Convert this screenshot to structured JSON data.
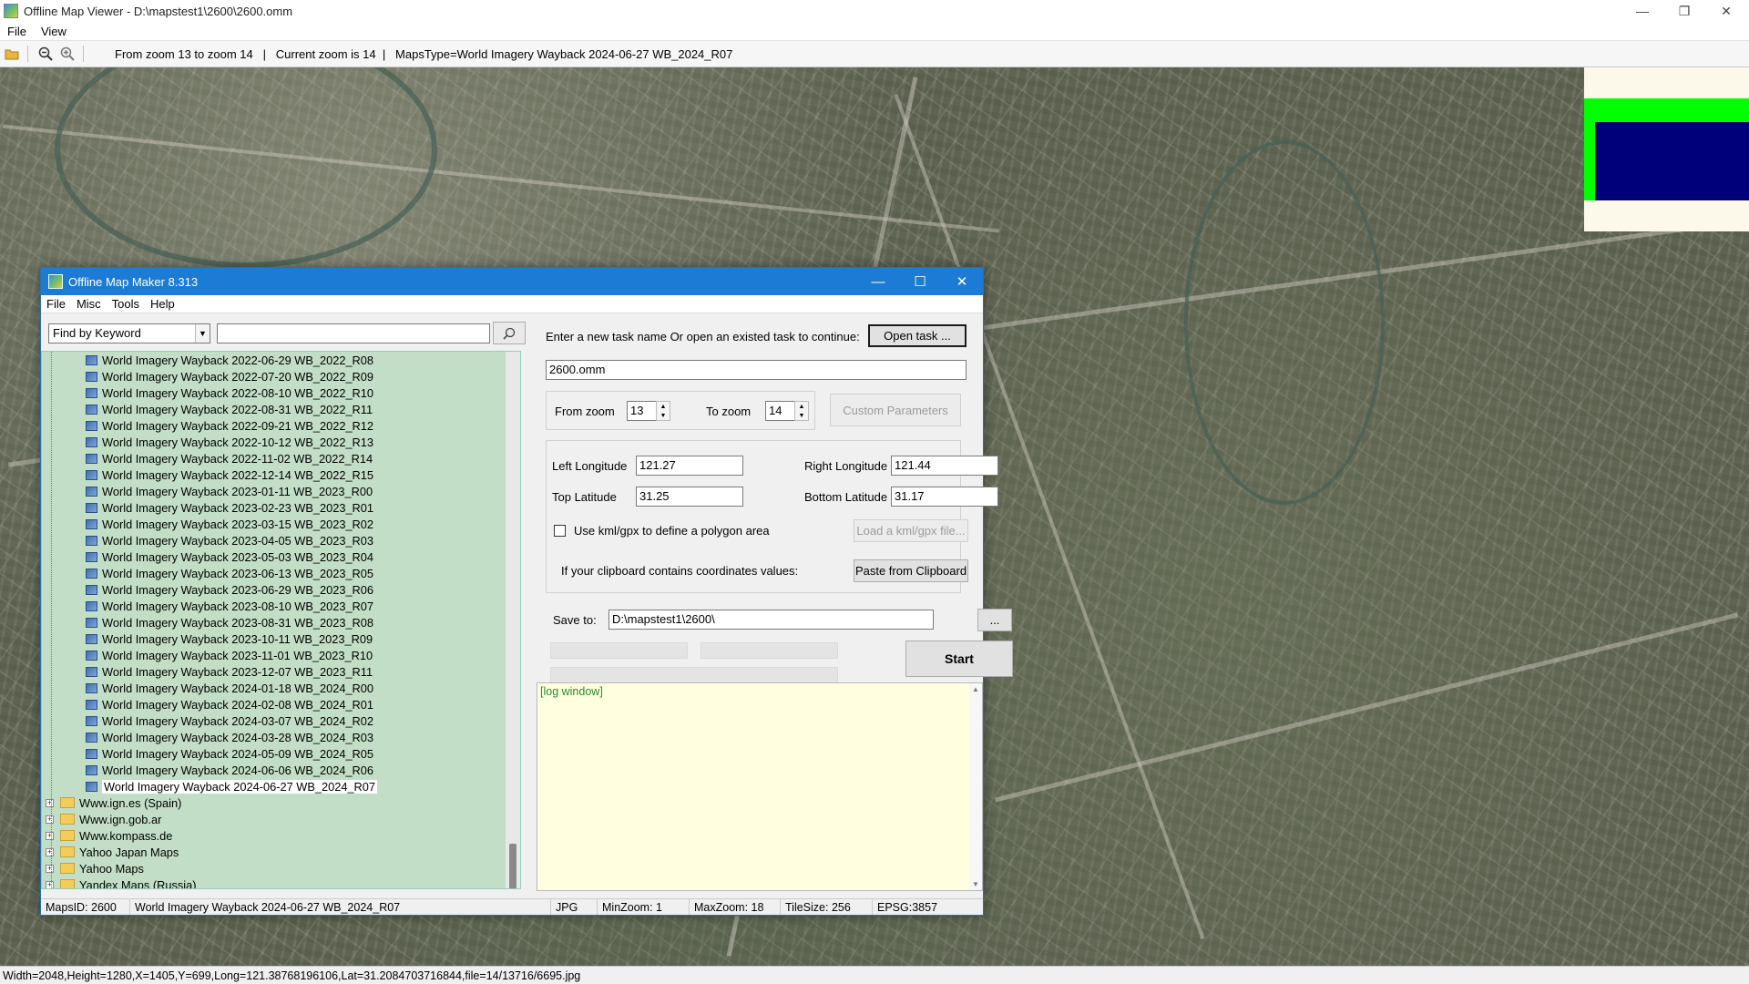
{
  "window": {
    "title": "Offline Map Viewer - D:\\mapstest1\\2600\\2600.omm",
    "controls": {
      "minimize": "—",
      "maximize": "❐",
      "close": "✕"
    }
  },
  "menu": [
    "File",
    "View"
  ],
  "toolbar": {
    "info": "From zoom 13 to zoom 14   |   Current zoom is 14  |   MapsType=World Imagery Wayback 2024-06-27 WB_2024_R07"
  },
  "statusbar": {
    "text": "Width=2048,Height=1280,X=1405,Y=699,Long=121.38768196106,Lat=31.2084703716844,file=14/13716/6695.jpg"
  },
  "dialog": {
    "title": "Offline Map Maker 8.313",
    "menu": [
      "File",
      "Misc",
      "Tools",
      "Help"
    ],
    "search": {
      "mode": "Find by Keyword",
      "keyword": ""
    },
    "tree": {
      "leaves": [
        "World Imagery Wayback 2022-06-29 WB_2022_R08",
        "World Imagery Wayback 2022-07-20 WB_2022_R09",
        "World Imagery Wayback 2022-08-10 WB_2022_R10",
        "World Imagery Wayback 2022-08-31 WB_2022_R11",
        "World Imagery Wayback 2022-09-21 WB_2022_R12",
        "World Imagery Wayback 2022-10-12 WB_2022_R13",
        "World Imagery Wayback 2022-11-02 WB_2022_R14",
        "World Imagery Wayback 2022-12-14 WB_2022_R15",
        "World Imagery Wayback 2023-01-11 WB_2023_R00",
        "World Imagery Wayback 2023-02-23 WB_2023_R01",
        "World Imagery Wayback 2023-03-15 WB_2023_R02",
        "World Imagery Wayback 2023-04-05 WB_2023_R03",
        "World Imagery Wayback 2023-05-03 WB_2023_R04",
        "World Imagery Wayback 2023-06-13 WB_2023_R05",
        "World Imagery Wayback 2023-06-29 WB_2023_R06",
        "World Imagery Wayback 2023-08-10 WB_2023_R07",
        "World Imagery Wayback 2023-08-31 WB_2023_R08",
        "World Imagery Wayback 2023-10-11 WB_2023_R09",
        "World Imagery Wayback 2023-11-01 WB_2023_R10",
        "World Imagery Wayback 2023-12-07 WB_2023_R11",
        "World Imagery Wayback 2024-01-18 WB_2024_R00",
        "World Imagery Wayback 2024-02-08 WB_2024_R01",
        "World Imagery Wayback 2024-03-07 WB_2024_R02",
        "World Imagery Wayback 2024-03-28 WB_2024_R03",
        "World Imagery Wayback 2024-05-09 WB_2024_R05",
        "World Imagery Wayback 2024-06-06 WB_2024_R06",
        "World Imagery Wayback 2024-06-27 WB_2024_R07"
      ],
      "selected": "World Imagery Wayback 2024-06-27 WB_2024_R07",
      "folders": [
        "Www.ign.es (Spain)",
        "Www.ign.gob.ar",
        "Www.kompass.de",
        "Yahoo Japan Maps",
        "Yahoo Maps",
        "Yandex Maps (Russia)"
      ]
    },
    "task": {
      "prompt": "Enter a new task name Or open an existed task to continue:",
      "open_label": "Open task ...",
      "name": "2600.omm"
    },
    "zoom": {
      "from_label": "From zoom",
      "from_value": "13",
      "to_label": "To zoom",
      "to_value": "14",
      "custom_label": "Custom Parameters"
    },
    "coords": {
      "left_label": "Left Longitude",
      "left_value": "121.27",
      "right_label": "Right Longitude",
      "right_value": "121.44",
      "top_label": "Top Latitude",
      "top_value": "31.25",
      "bottom_label": "Bottom Latitude",
      "bottom_value": "31.17",
      "kml_label": "Use kml/gpx to define a polygon area",
      "kml_button": "Load a kml/gpx file...",
      "clipboard_label": "If your clipboard contains coordinates values:",
      "clipboard_button": "Paste from Clipboard"
    },
    "save": {
      "label": "Save to:",
      "path": "D:\\mapstest1\\2600\\",
      "browse": "..."
    },
    "start_label": "Start",
    "log": "[log window]",
    "status": {
      "maps_id": "MapsID: 2600",
      "map_name": "World Imagery Wayback 2024-06-27 WB_2024_R07",
      "format": "JPG",
      "min_zoom": "MinZoom: 1",
      "max_zoom": "MaxZoom: 18",
      "tile_size": "TileSize: 256",
      "epsg": "EPSG:3857"
    }
  },
  "overview_colors": {
    "background": "#fdf9ea",
    "frame": "#00ff00",
    "viewport": "#00007a"
  }
}
